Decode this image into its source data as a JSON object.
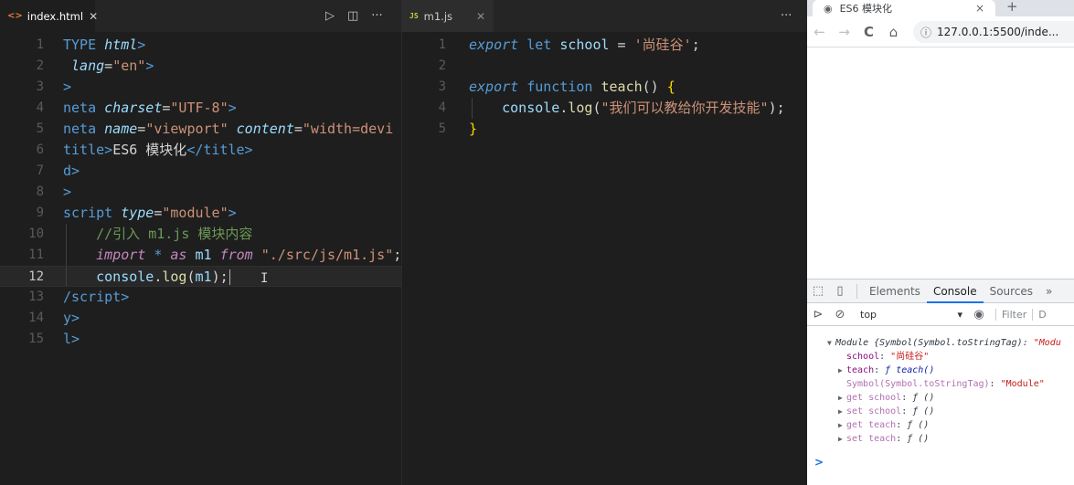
{
  "left_editor": {
    "tab_label": "index.html",
    "tab_icon": "<>",
    "close_glyph": "✕",
    "actions": [
      "▷",
      "◫",
      "···"
    ],
    "lines": [
      {
        "n": "1",
        "parts": [
          [
            "tag",
            "TYPE "
          ],
          [
            "attr",
            "html"
          ],
          [
            "tag",
            ">"
          ]
        ]
      },
      {
        "n": "2",
        "parts": [
          [
            "attr",
            " lang"
          ],
          [
            "plain",
            "="
          ],
          [
            "str",
            "\"en\""
          ],
          [
            "tag",
            ">"
          ]
        ]
      },
      {
        "n": "3",
        "parts": [
          [
            "tag",
            ">"
          ]
        ]
      },
      {
        "n": "4",
        "parts": [
          [
            "tag",
            "neta "
          ],
          [
            "attr",
            "charset"
          ],
          [
            "plain",
            "="
          ],
          [
            "str",
            "\"UTF-8\""
          ],
          [
            "tag",
            ">"
          ]
        ]
      },
      {
        "n": "5",
        "parts": [
          [
            "tag",
            "neta "
          ],
          [
            "attr",
            "name"
          ],
          [
            "plain",
            "="
          ],
          [
            "str",
            "\"viewport\" "
          ],
          [
            "attr",
            "content"
          ],
          [
            "plain",
            "="
          ],
          [
            "str",
            "\"width=devi"
          ]
        ]
      },
      {
        "n": "6",
        "parts": [
          [
            "tag",
            "title>"
          ],
          [
            "plain",
            "ES6 模块化"
          ],
          [
            "tag",
            "</title>"
          ]
        ]
      },
      {
        "n": "7",
        "parts": [
          [
            "tag",
            "d>"
          ]
        ]
      },
      {
        "n": "8",
        "parts": [
          [
            "tag",
            ">"
          ]
        ]
      },
      {
        "n": "9",
        "parts": [
          [
            "tag",
            "script "
          ],
          [
            "attr",
            "type"
          ],
          [
            "plain",
            "="
          ],
          [
            "str",
            "\"module\""
          ],
          [
            "tag",
            ">"
          ]
        ]
      },
      {
        "n": "10",
        "parts": [
          [
            "plain",
            "    "
          ],
          [
            "cmt",
            "//引入 m1.js 模块内容"
          ]
        ]
      },
      {
        "n": "11",
        "parts": [
          [
            "plain",
            "    "
          ],
          [
            "ctrl",
            "import "
          ],
          [
            "kw",
            "* "
          ],
          [
            "ctrl",
            "as "
          ],
          [
            "var",
            "m1 "
          ],
          [
            "ctrl",
            "from "
          ],
          [
            "str",
            "\"./src/js/m1.js\""
          ],
          [
            "plain",
            ";"
          ]
        ]
      },
      {
        "n": "12",
        "parts": [
          [
            "plain",
            "    "
          ],
          [
            "var",
            "console"
          ],
          [
            "plain",
            "."
          ],
          [
            "fn",
            "log"
          ],
          [
            "plain",
            "("
          ],
          [
            "var",
            "m1"
          ],
          [
            "plain",
            ");"
          ]
        ]
      },
      {
        "n": "13",
        "parts": [
          [
            "tag",
            "/script>"
          ]
        ]
      },
      {
        "n": "14",
        "parts": [
          [
            "tag",
            "y>"
          ]
        ]
      },
      {
        "n": "15",
        "parts": [
          [
            "tag",
            "l>"
          ]
        ]
      }
    ]
  },
  "right_editor": {
    "tab_label": "m1.js",
    "tab_icon": "JS",
    "close_glyph": "✕",
    "more": "···",
    "lines": [
      {
        "n": "1",
        "parts": [
          [
            "ita-kw",
            "export "
          ],
          [
            "kw",
            "let "
          ],
          [
            "var",
            "school"
          ],
          [
            "plain",
            " = "
          ],
          [
            "str",
            "'尚硅谷'"
          ],
          [
            "plain",
            ";"
          ]
        ]
      },
      {
        "n": "2",
        "parts": []
      },
      {
        "n": "3",
        "parts": [
          [
            "ita-kw",
            "export "
          ],
          [
            "kw",
            "function "
          ],
          [
            "fn",
            "teach"
          ],
          [
            "plain",
            "() "
          ],
          [
            "brace",
            "{"
          ]
        ]
      },
      {
        "n": "4",
        "parts": [
          [
            "plain",
            "    "
          ],
          [
            "var",
            "console"
          ],
          [
            "plain",
            "."
          ],
          [
            "fn",
            "log"
          ],
          [
            "plain",
            "("
          ],
          [
            "str",
            "\"我们可以教给你开发技能\""
          ],
          [
            "plain",
            ");"
          ]
        ]
      },
      {
        "n": "5",
        "parts": [
          [
            "brace",
            "}"
          ]
        ]
      }
    ]
  },
  "browser": {
    "tab_title": "ES6 模块化",
    "tab_close": "×",
    "new_tab": "+",
    "url": "127.0.0.1:5500/inde...",
    "nav": {
      "back": "←",
      "forward": "→",
      "reload": "C",
      "home": "⌂"
    }
  },
  "devtools": {
    "tabs": [
      "Elements",
      "Console",
      "Sources",
      "»"
    ],
    "active_tab": "Console",
    "context": "top",
    "filter_placeholder": "Filter",
    "filter_trailing": "D",
    "console": {
      "module_label": "Module",
      "module_summary": " {Symbol(Symbol.toStringTag): ",
      "module_summary_str": "\"Modu",
      "school_key": "school",
      "school_val": "\"尚硅谷\"",
      "teach_key": "teach",
      "teach_val": "ƒ teach()",
      "symbol_key": "Symbol(Symbol.toStringTag)",
      "symbol_val": "\"Module\"",
      "accessors": [
        {
          "key": "get school",
          "val": "ƒ ()"
        },
        {
          "key": "set school",
          "val": "ƒ ()"
        },
        {
          "key": "get teach",
          "val": "ƒ ()"
        },
        {
          "key": "set teach",
          "val": "ƒ ()"
        }
      ],
      "prompt": ">"
    }
  }
}
